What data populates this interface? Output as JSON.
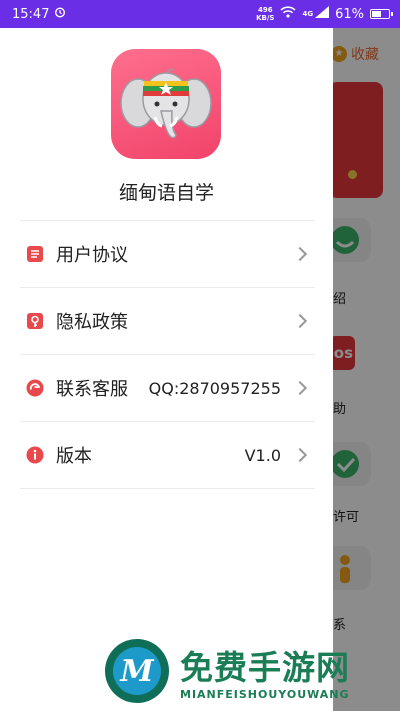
{
  "status_bar": {
    "time": "15:47",
    "net_speed_value": "496",
    "net_speed_unit": "KB/S",
    "network": "4G",
    "battery_percent": "61%",
    "battery_level": 0.61
  },
  "background": {
    "favorite_label": "收藏",
    "label_1": "绍",
    "label_2": "助",
    "label_3": "许可",
    "label_4": "系",
    "tile_badge": "os"
  },
  "drawer": {
    "app_name": "缅甸语自学",
    "menu": [
      {
        "label": "用户协议",
        "value": "",
        "icon": "document-icon",
        "color": "#e9484c"
      },
      {
        "label": "隐私政策",
        "value": "",
        "icon": "lock-icon",
        "color": "#e9484c"
      },
      {
        "label": "联系客服",
        "value": "QQ:2870957255",
        "icon": "customer-service-icon",
        "color": "#e9484c"
      },
      {
        "label": "版本",
        "value": "V1.0",
        "icon": "info-icon",
        "color": "#e9484c"
      }
    ]
  },
  "watermark": {
    "title": "免费手游网",
    "subtitle": "MIANFEISHOUYOUWANG"
  }
}
